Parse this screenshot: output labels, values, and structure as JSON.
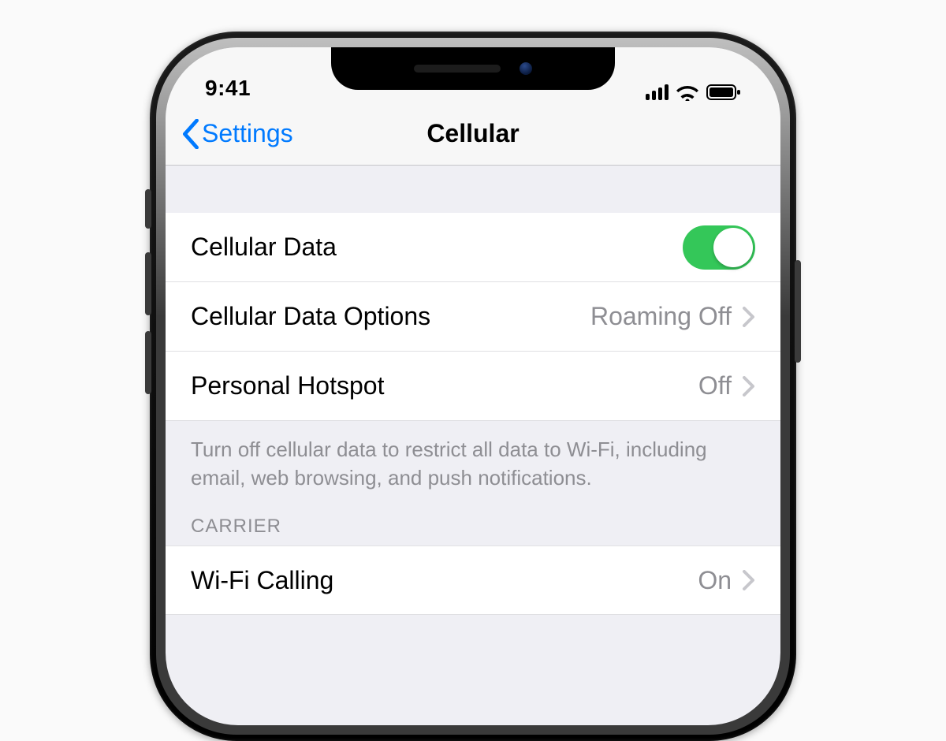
{
  "statusbar": {
    "time": "9:41"
  },
  "nav": {
    "back": "Settings",
    "title": "Cellular"
  },
  "rows": {
    "cellular_data": {
      "label": "Cellular Data",
      "on": true
    },
    "options": {
      "label": "Cellular Data Options",
      "value": "Roaming Off"
    },
    "hotspot": {
      "label": "Personal Hotspot",
      "value": "Off"
    }
  },
  "footer": "Turn off cellular data to restrict all data to Wi-Fi, including email, web browsing, and push notifications.",
  "section2": {
    "header": "CARRIER",
    "wifi_calling": {
      "label": "Wi-Fi Calling",
      "value": "On"
    }
  }
}
